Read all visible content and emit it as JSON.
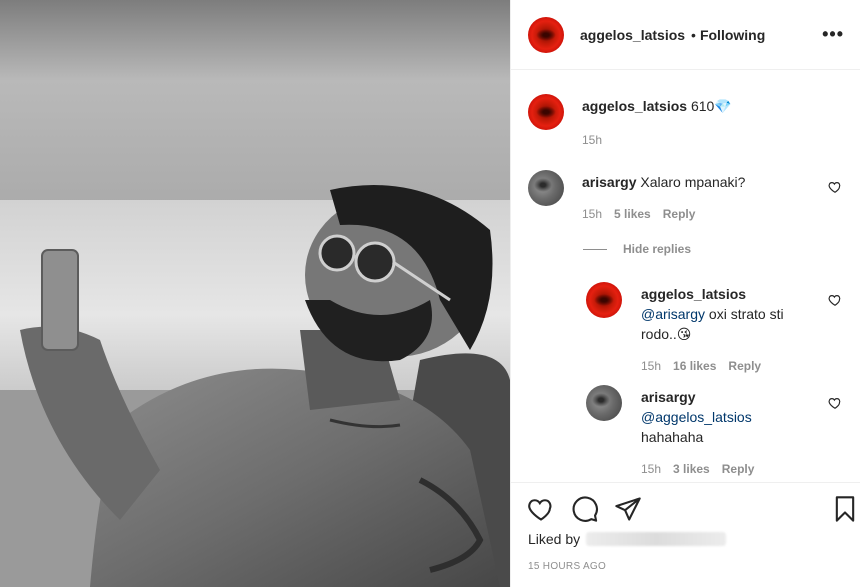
{
  "header": {
    "username": "aggelos_latsios",
    "separator": "•",
    "follow_status": "Following",
    "more_label": "•••"
  },
  "caption": {
    "username": "aggelos_latsios",
    "text": "610💎",
    "time": "15h"
  },
  "comments": [
    {
      "username": "arisargy",
      "text": "Xalaro mpanaki?",
      "time": "15h",
      "likes": "5 likes",
      "reply_label": "Reply"
    }
  ],
  "hide_replies_label": "Hide replies",
  "replies": [
    {
      "username": "aggelos_latsios",
      "mention": "@arisargy",
      "text_line1": " oxi strato sti",
      "text_line2": "rodo..😘",
      "time": "15h",
      "likes": "16 likes",
      "reply_label": "Reply"
    },
    {
      "username": "arisargy",
      "mention": "@aggelos_latsios",
      "text": "hahahaha",
      "time": "15h",
      "likes": "3 likes",
      "reply_label": "Reply"
    }
  ],
  "footer": {
    "liked_by_label": "Liked by",
    "time_ago": "15 HOURS AGO"
  },
  "colors": {
    "link": "#00376b",
    "muted": "#8e8e8e",
    "text": "#262626",
    "avatar_red": "#c41a08"
  },
  "icons": [
    "heart-icon",
    "comment-icon",
    "share-icon",
    "bookmark-icon",
    "more-icon"
  ]
}
